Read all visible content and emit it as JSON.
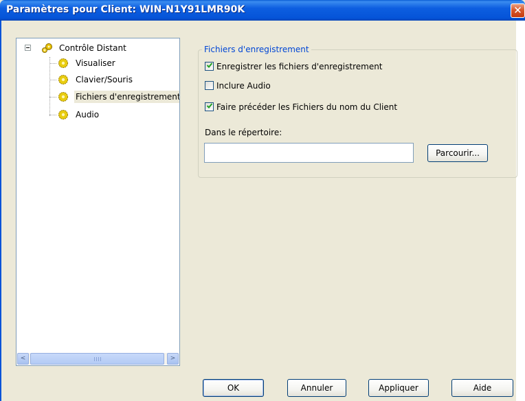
{
  "window": {
    "title": "Paramètres pour Client: WIN-N1Y91LMR90K",
    "close_glyph": "✕"
  },
  "tree": {
    "root": {
      "label": "Contrôle Distant",
      "icon": "gears-icon",
      "expanded": true
    },
    "items": [
      {
        "label": "Visualiser",
        "icon": "gear-icon",
        "selected": false
      },
      {
        "label": "Clavier/Souris",
        "icon": "gear-icon",
        "selected": false
      },
      {
        "label": "Fichiers d'enregistrement",
        "icon": "gear-icon",
        "selected": true
      },
      {
        "label": "Audio",
        "icon": "gear-icon",
        "selected": false
      }
    ],
    "scrollbar": {
      "left_arrow": "<",
      "right_arrow": ">",
      "grip": "III"
    }
  },
  "group": {
    "title": "Fichiers d'enregistrement",
    "checkboxes": [
      {
        "label": "Enregistrer les fichiers d'enregistrement",
        "checked": true
      },
      {
        "label": "Inclure Audio",
        "checked": false
      },
      {
        "label": "Faire précéder les Fichiers du nom du Client",
        "checked": true
      }
    ],
    "directory_label": "Dans le répertoire:",
    "directory_value": "",
    "browse_label": "Parcourir..."
  },
  "buttons": {
    "ok": "OK",
    "cancel": "Annuler",
    "apply": "Appliquer",
    "help": "Aide"
  },
  "colors": {
    "title_bar": "#0554d8",
    "dialog_bg": "#ece9d8",
    "group_title": "#0046d5",
    "close_button": "#d9582b"
  }
}
